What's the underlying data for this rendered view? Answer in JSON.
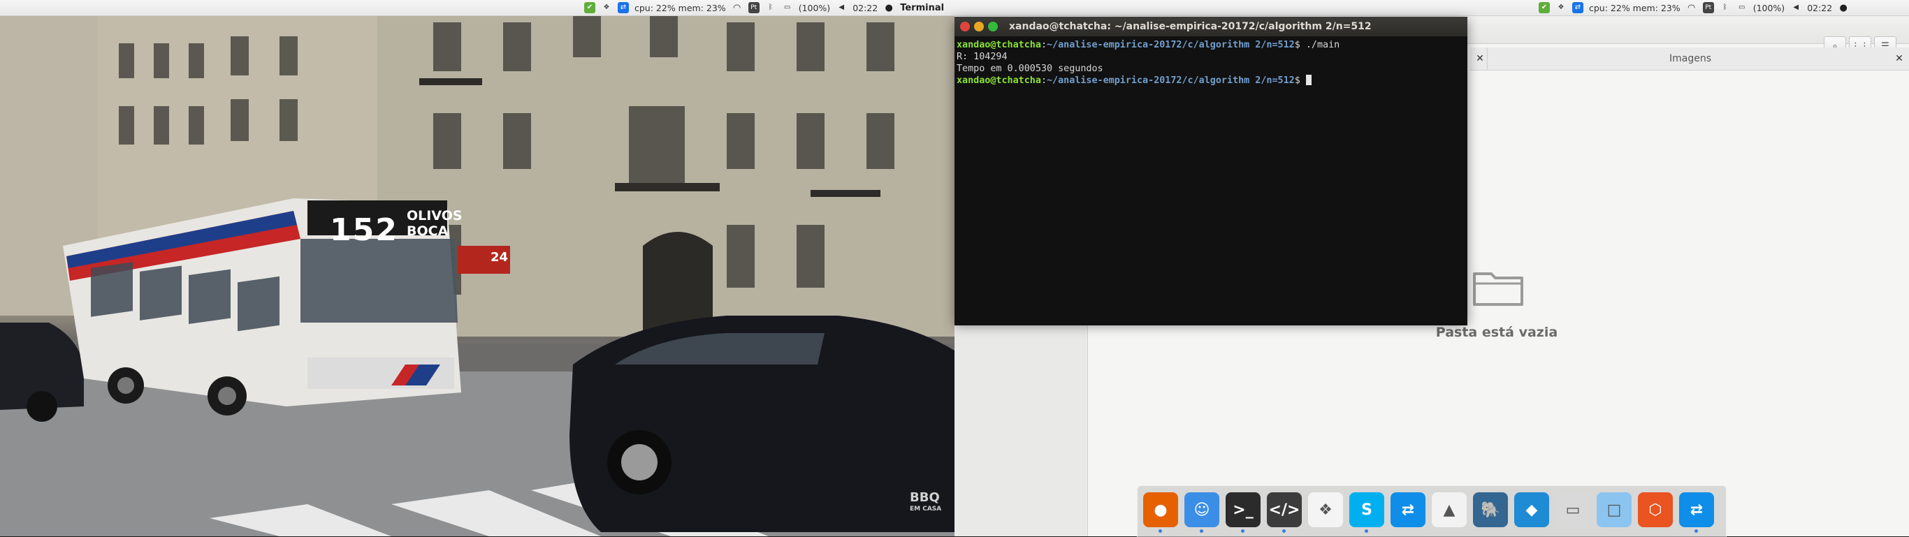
{
  "left_menubar": {
    "app_name": "Terminal",
    "cpu_mem": "cpu: 22% mem: 23%",
    "battery": "(100%)",
    "clock": "02:22",
    "keyboard_layout": "Pt"
  },
  "right_menubar": {
    "cpu_mem": "cpu: 22% mem: 23%",
    "battery": "(100%)",
    "clock": "02:22",
    "keyboard_layout": "Pt"
  },
  "terminal": {
    "title": "xandao@tchatcha: ~/analise-empirica-20172/c/algorithm 2/n=512",
    "lines": [
      {
        "user": "xandao@tchatcha",
        "sep": ":",
        "path": "~/analise-empirica-20172/c/algorithm 2/n=512",
        "prompt": "$",
        "cmd": " ./main"
      },
      {
        "text": "R: 104294"
      },
      {
        "text": "Tempo em 0.000530 segundos"
      },
      {
        "user": "xandao@tchatcha",
        "sep": ":",
        "path": "~/analise-empirica-20172/c/algorithm 2/n=512",
        "prompt": "$",
        "cmd": " "
      }
    ]
  },
  "files": {
    "tab_label": "Imagens",
    "empty_message": "Pasta está vazia",
    "search_icon": "search-icon",
    "view_icon": "grid-view-icon",
    "menu_icon": "menu-icon"
  },
  "wallpaper": {
    "bus_route": "152",
    "bus_destination_line1": "OLIVOS",
    "bus_destination_line2": "BOCA",
    "watermark_line1": "BBQ",
    "watermark_line2": "EM CASA",
    "sign_number": "24"
  },
  "dock": {
    "items": [
      {
        "name": "firefox-icon",
        "bg": "#e66000",
        "glyph": "●",
        "running": true
      },
      {
        "name": "finder-icon",
        "bg": "#3b8ee6",
        "glyph": "☺",
        "running": true
      },
      {
        "name": "terminal-icon",
        "bg": "#2b2b2b",
        "glyph": ">_",
        "running": true
      },
      {
        "name": "code-editor-icon",
        "bg": "#3c3c3c",
        "glyph": "</>",
        "running": true
      },
      {
        "name": "dropbox-icon",
        "bg": "#f4f4f4",
        "glyph": "❖",
        "running": false
      },
      {
        "name": "skype-icon",
        "bg": "#00aff0",
        "glyph": "S",
        "running": true
      },
      {
        "name": "teamviewer-icon",
        "bg": "#0e8ee9",
        "glyph": "⇄",
        "running": false
      },
      {
        "name": "matlab-icon",
        "bg": "#f2f2f2",
        "glyph": "▲",
        "running": false
      },
      {
        "name": "postgresql-icon",
        "bg": "#336791",
        "glyph": "🐘",
        "running": false
      },
      {
        "name": "mysql-workbench-icon",
        "bg": "#1f8bd4",
        "glyph": "◆",
        "running": false
      },
      {
        "name": "scanner-icon",
        "bg": "#d9d9d9",
        "glyph": "▭",
        "running": false
      },
      {
        "name": "virtualbox-icon",
        "bg": "#8cc4f0",
        "glyph": "□",
        "running": false
      },
      {
        "name": "ubuntu-software-icon",
        "bg": "#e95420",
        "glyph": "⬡",
        "running": false
      },
      {
        "name": "teamviewer-2-icon",
        "bg": "#0e8ee9",
        "glyph": "⇄",
        "running": true
      }
    ]
  }
}
